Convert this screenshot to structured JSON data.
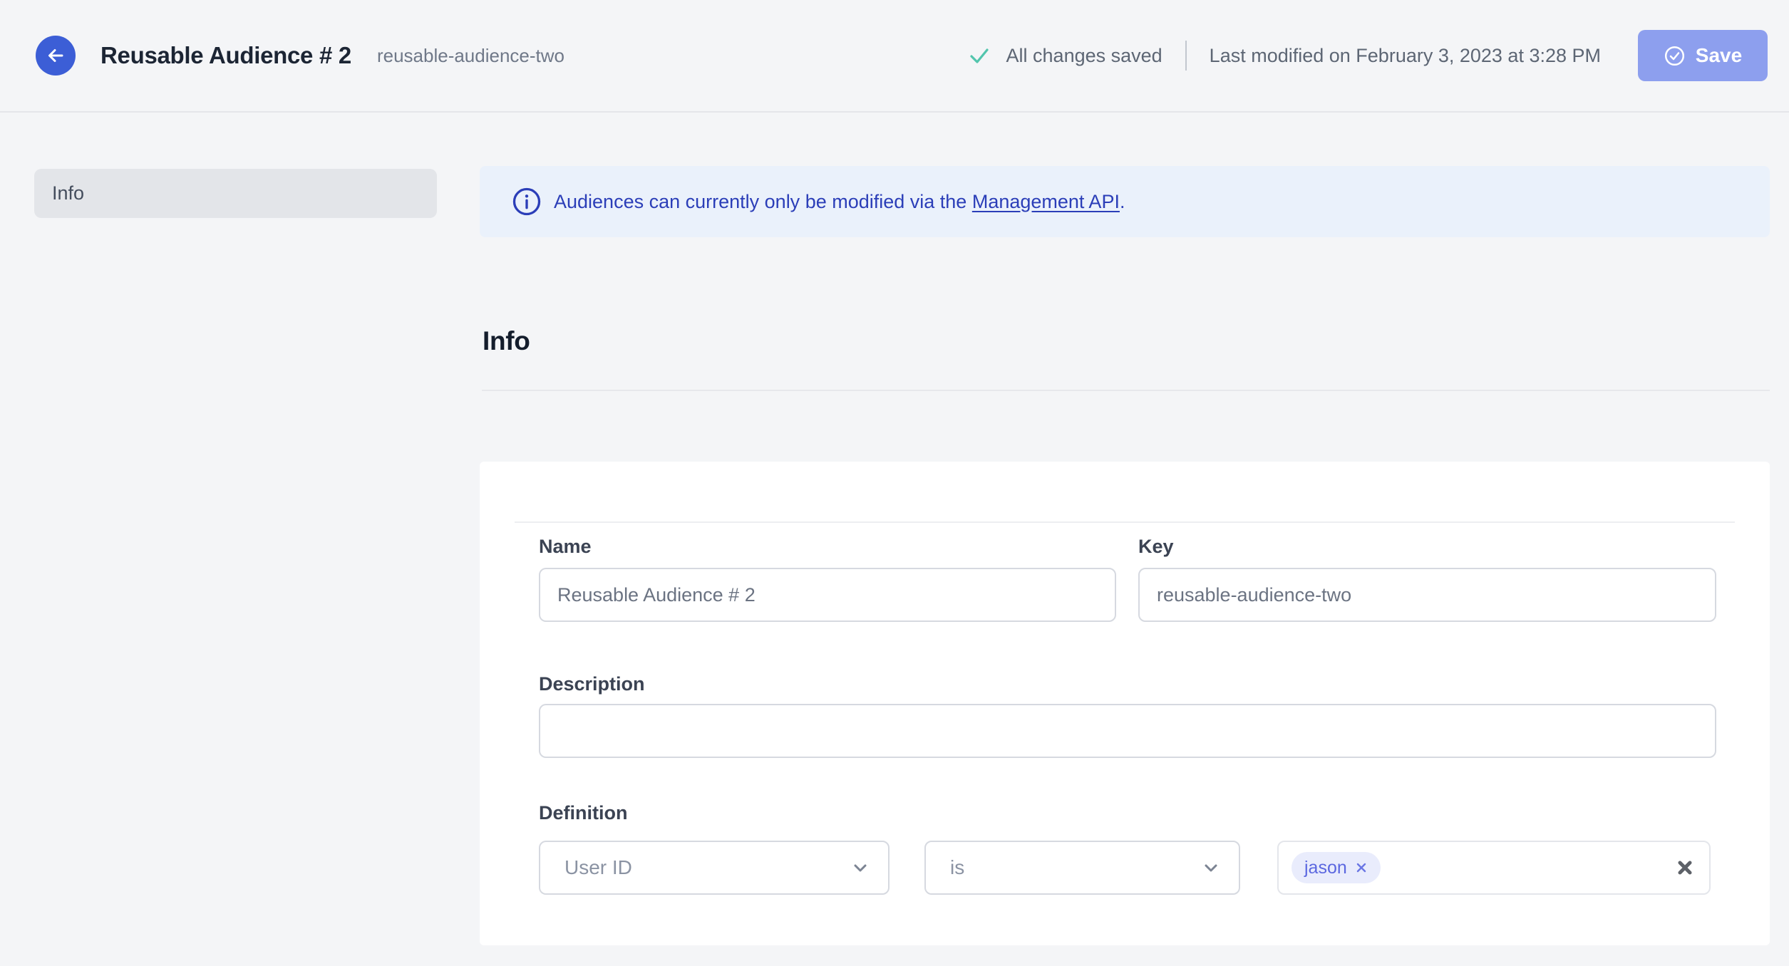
{
  "header": {
    "title": "Reusable Audience # 2",
    "slug": "reusable-audience-two",
    "saved_status": "All changes saved",
    "last_modified": "Last modified on February 3, 2023 at 3:28 PM",
    "save_label": "Save"
  },
  "sidebar": {
    "items": [
      {
        "label": "Info"
      }
    ]
  },
  "banner": {
    "text_before_link": "Audiences can currently only be modified via the ",
    "link_text": "Management API",
    "text_after_link": "."
  },
  "section": {
    "title": "Info"
  },
  "form": {
    "name": {
      "label": "Name",
      "value": "Reusable Audience # 2"
    },
    "key": {
      "label": "Key",
      "value": "reusable-audience-two"
    },
    "description": {
      "label": "Description",
      "value": ""
    },
    "definition": {
      "label": "Definition",
      "trait_selected": "User ID",
      "operator_selected": "is",
      "values": [
        "jason"
      ]
    }
  },
  "icons": {
    "back": "arrow-left-icon",
    "saved": "check-icon",
    "save": "circle-check-icon",
    "banner": "info-circle-icon",
    "dropdown": "chevron-down-icon",
    "chip_remove": "x-icon",
    "clear": "x-icon"
  },
  "colors": {
    "accent_blue": "#3c5ed6",
    "save_button": "#8d9fee",
    "success_teal": "#52c5ad",
    "banner_bg": "#eaf1fb",
    "banner_text": "#2b3eb8",
    "page_bg": "#f4f5f7",
    "chip_bg": "#e9ecfc",
    "chip_text": "#5b67e0"
  }
}
